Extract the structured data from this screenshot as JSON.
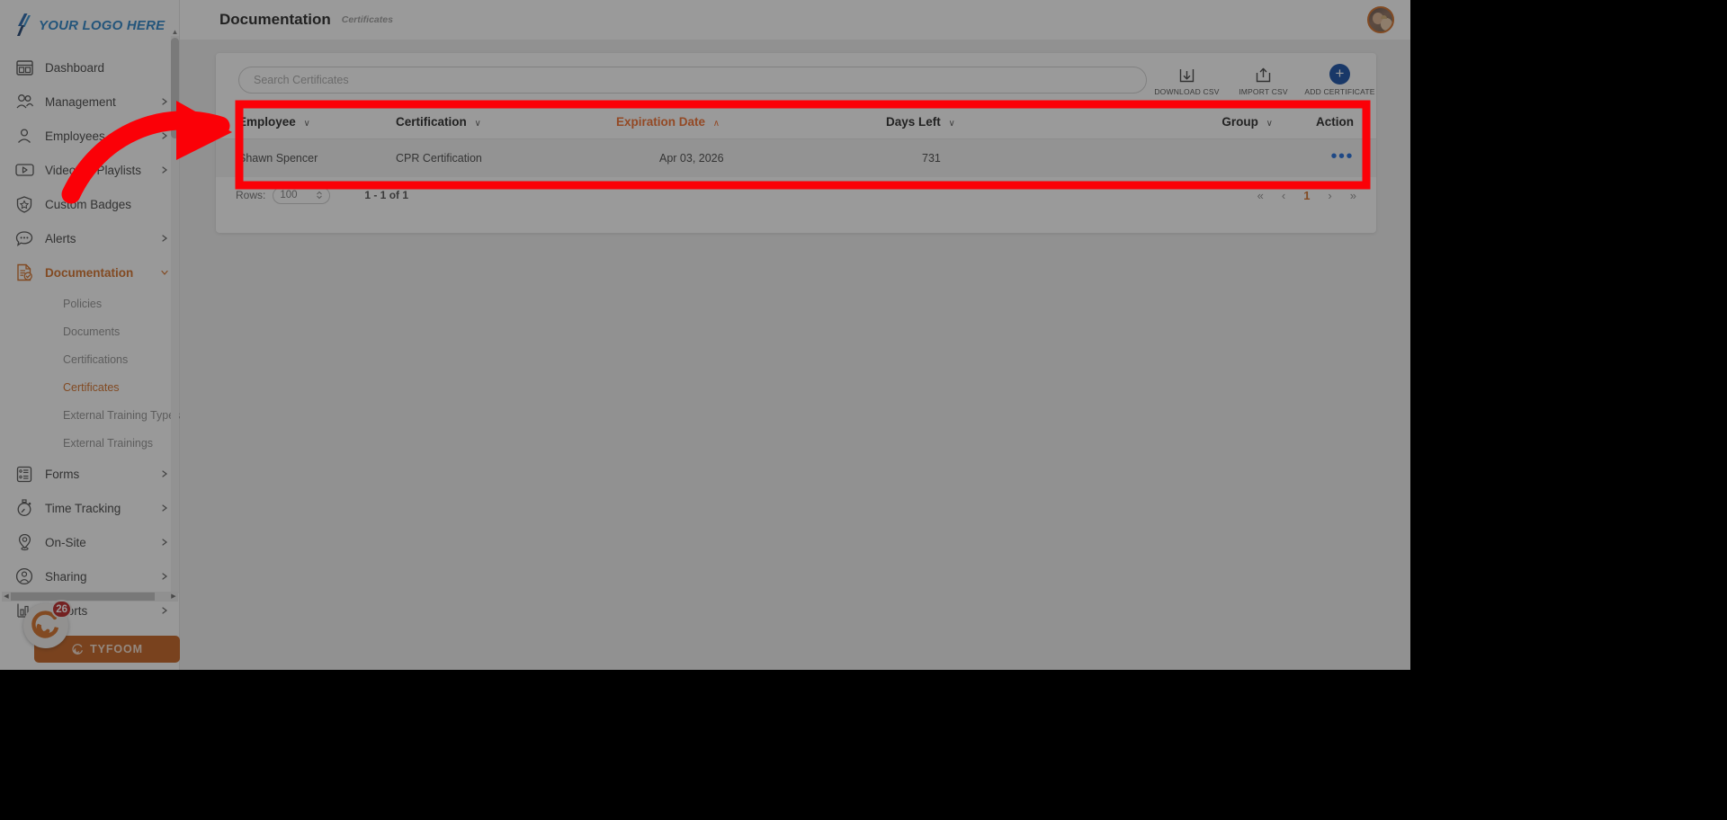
{
  "brand": {
    "logo_text": "YOUR LOGO HERE",
    "logo_color": "#1f7dc4",
    "accent_orange": "#d2691e",
    "sort_orange": "#f26722",
    "action_blue": "#1565d8",
    "add_button_blue": "#0d47a1",
    "annotation_red": "#fb0007"
  },
  "sidebar": {
    "items": [
      {
        "label": "Dashboard",
        "icon": "dashboard-icon",
        "expandable": false,
        "active": false
      },
      {
        "label": "Management",
        "icon": "people-icon",
        "expandable": true,
        "active": false
      },
      {
        "label": "Employees",
        "icon": "person-icon",
        "expandable": true,
        "active": false
      },
      {
        "label": "Videos & Playlists",
        "icon": "video-play-icon",
        "expandable": true,
        "active": false
      },
      {
        "label": "Custom Badges",
        "icon": "shield-star-icon",
        "expandable": false,
        "active": false
      },
      {
        "label": "Alerts",
        "icon": "chat-bubble-icon",
        "expandable": true,
        "active": false
      },
      {
        "label": "Documentation",
        "icon": "document-check-icon",
        "expandable": true,
        "active": true,
        "expanded": true
      }
    ],
    "documentation_children": [
      {
        "label": "Policies",
        "active": false
      },
      {
        "label": "Documents",
        "active": false
      },
      {
        "label": "Certifications",
        "active": false
      },
      {
        "label": "Certificates",
        "active": true
      },
      {
        "label": "External Training Types",
        "active": false
      },
      {
        "label": "External Trainings",
        "active": false
      }
    ],
    "items_after": [
      {
        "label": "Forms",
        "icon": "form-list-icon",
        "expandable": true
      },
      {
        "label": "Time Tracking",
        "icon": "stopwatch-icon",
        "expandable": true
      },
      {
        "label": "On-Site",
        "icon": "map-pin-icon",
        "expandable": true
      },
      {
        "label": "Sharing",
        "icon": "share-person-icon",
        "expandable": true
      },
      {
        "label": "Reports",
        "icon": "bar-chart-icon",
        "expandable": true
      }
    ],
    "tyfoom": {
      "label": "TYFOOM",
      "badge_count": "26"
    }
  },
  "header": {
    "title": "Documentation",
    "subtitle": "Certificates",
    "avatar_name": "user-avatar"
  },
  "search": {
    "placeholder": "Search Certificates",
    "value": ""
  },
  "toolbar": [
    {
      "label": "DOWNLOAD CSV",
      "icon": "download-csv-icon"
    },
    {
      "label": "IMPORT CSV",
      "icon": "import-csv-icon"
    },
    {
      "label": "ADD CERTIFICATE",
      "icon": "plus-circle-icon"
    }
  ],
  "table": {
    "columns": [
      {
        "label": "Employee",
        "sortable": true,
        "sorted": false,
        "direction": "down"
      },
      {
        "label": "Certification",
        "sortable": true,
        "sorted": false,
        "direction": "down"
      },
      {
        "label": "Expiration Date",
        "sortable": true,
        "sorted": true,
        "direction": "up"
      },
      {
        "label": "Days Left",
        "sortable": true,
        "sorted": false,
        "direction": "down"
      },
      {
        "label": "Group",
        "sortable": true,
        "sorted": false,
        "direction": "down"
      },
      {
        "label": "Action",
        "sortable": false,
        "sorted": false,
        "direction": ""
      }
    ],
    "rows": [
      {
        "employee": "Shawn Spencer",
        "certification": "CPR Certification",
        "expiration_date": "Apr 03, 2026",
        "days_left": "731",
        "group": "",
        "action": "•••"
      }
    ]
  },
  "pagination": {
    "rows_label": "Rows:",
    "rows_value": "100",
    "range_text": "1 - 1 of 1",
    "first_label": "«",
    "prev_label": "‹",
    "current_page": "1",
    "next_label": "›",
    "last_label": "»"
  }
}
